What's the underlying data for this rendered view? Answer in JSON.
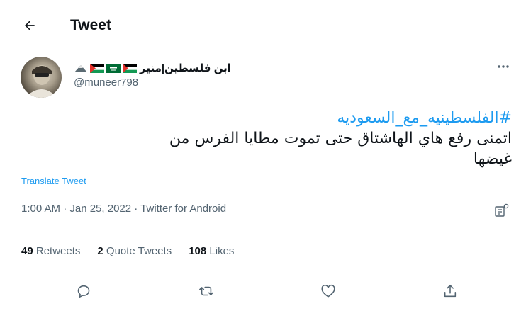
{
  "header": {
    "title": "Tweet",
    "back_icon": "arrow-left-icon"
  },
  "author": {
    "name": "ابن فلسطين|منير",
    "flags": [
      "palestine-flag-icon",
      "saudi-flag-icon",
      "palestine-flag-icon",
      "eagle-icon"
    ],
    "handle": "@muneer798"
  },
  "tweet": {
    "hashtag": "#الفلسطينيه_مع_السعوديه",
    "text_line_1": "اتمنى رفع هاي الهاشتاق حتى تموت مطايا الفرس من",
    "text_line_2": "غيضها"
  },
  "translate_label": "Translate Tweet",
  "meta": "1:00 AM · Jan 25, 2022 · Twitter for Android",
  "stats": {
    "retweets": {
      "count": "49",
      "label": "Retweets"
    },
    "quotes": {
      "count": "2",
      "label": "Quote Tweets"
    },
    "likes": {
      "count": "108",
      "label": "Likes"
    }
  },
  "actions": [
    "reply-icon",
    "retweet-icon",
    "like-icon",
    "share-icon"
  ],
  "colors": {
    "accent": "#1d9bf0",
    "secondary_text": "#536471",
    "primary_text": "#0f1419",
    "divider": "#eff3f4"
  }
}
